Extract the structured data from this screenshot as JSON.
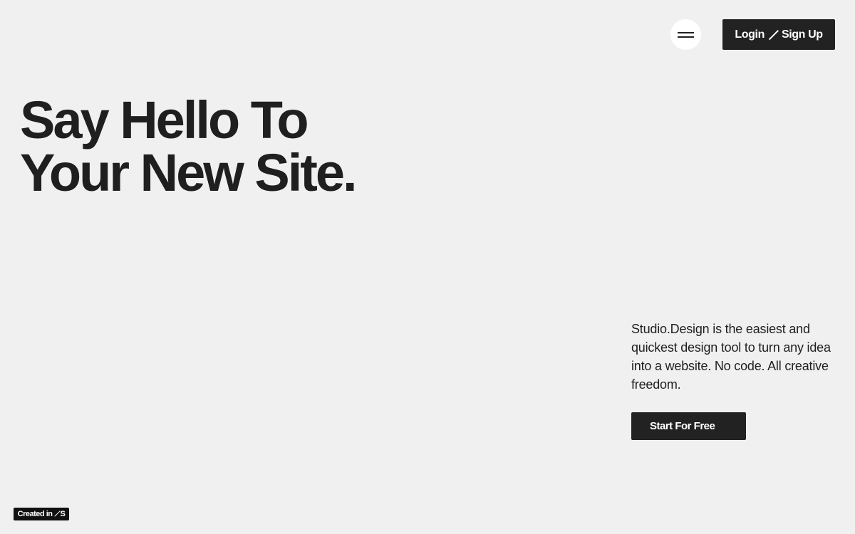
{
  "header": {
    "menu_icon": "hamburger-menu-icon",
    "auth": {
      "login_label": "Login",
      "separator_icon": "slash-icon",
      "signup_label": "Sign Up"
    }
  },
  "hero": {
    "title_line1": "Say Hello To",
    "title_line2": "Your New Site."
  },
  "intro": {
    "description": "Studio.Design is the easiest and quickest design tool to turn any idea into a website. No code. All creative freedom.",
    "cta_label": "Start For Free"
  },
  "footer_badge": {
    "prefix": "Created in",
    "logo_letter": "S",
    "logo_icon": "studio-logo-icon"
  },
  "colors": {
    "background": "#f0f0f0",
    "text": "#1f1f1f",
    "button_bg": "#222222",
    "button_text": "#ffffff"
  }
}
